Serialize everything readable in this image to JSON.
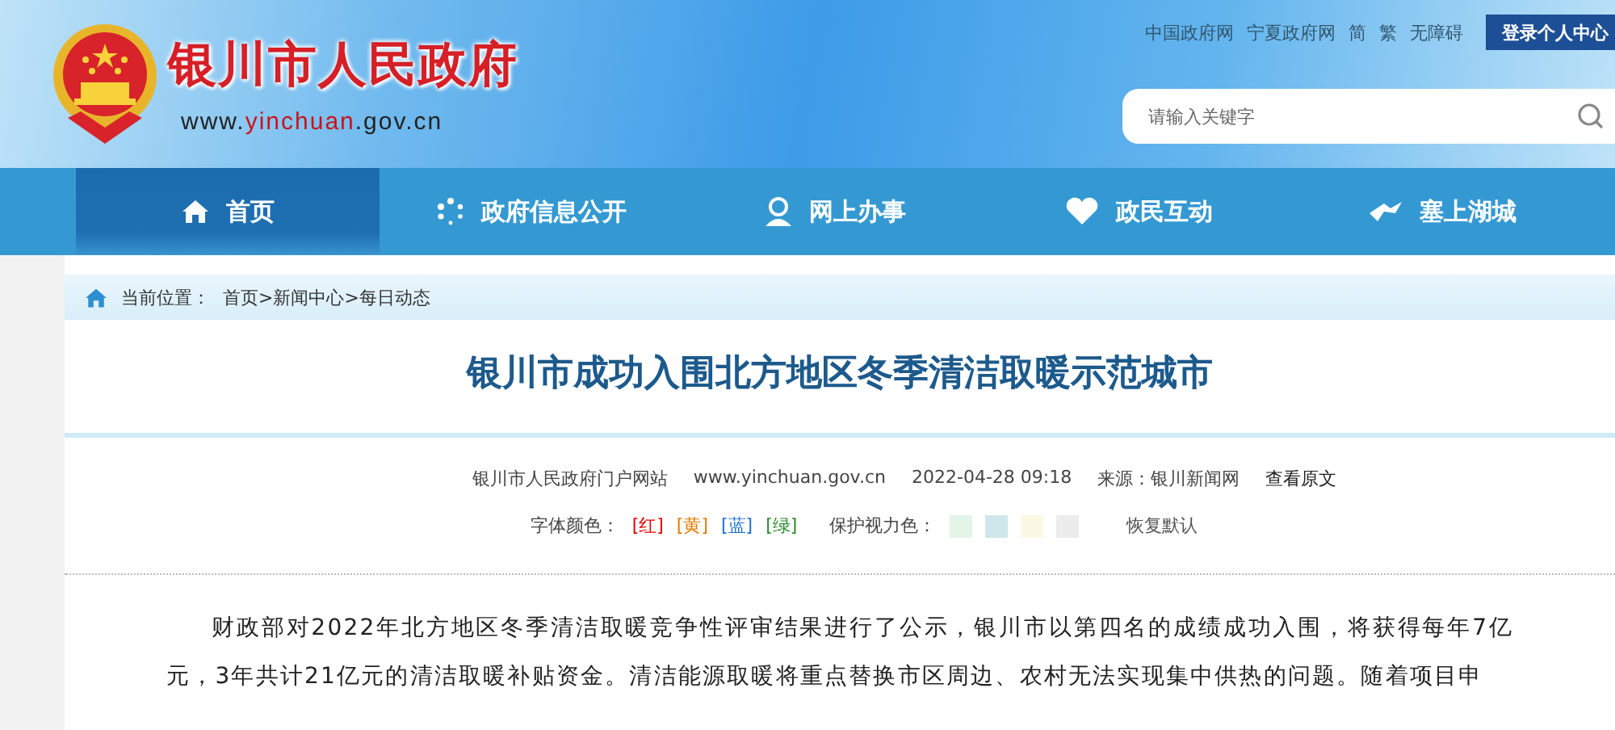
{
  "header": {
    "site_name": "银川市人民政府",
    "site_url": [
      {
        "text": "www.",
        "highlight": false
      },
      {
        "text": "yinchuan",
        "highlight": true
      },
      {
        "text": ".gov.cn",
        "highlight": false
      }
    ],
    "top_links": [
      "中国政府网",
      "宁夏政府网",
      "简",
      "繁",
      "无障碍"
    ],
    "login_button": "登录个人中心",
    "search": {
      "placeholder": "请输入关键字"
    }
  },
  "nav": [
    {
      "label": "首页",
      "kind": "home",
      "selected": true
    },
    {
      "label": "政府信息公开",
      "kind": "dots",
      "selected": false
    },
    {
      "label": "网上办事",
      "kind": "person",
      "selected": false
    },
    {
      "label": "政民互动",
      "kind": "heart",
      "selected": false
    },
    {
      "label": "塞上湖城",
      "kind": "bird",
      "selected": false
    }
  ],
  "breadcrumb": {
    "label": "当前位置：",
    "path": "首页>新闻中心>每日动态"
  },
  "article": {
    "title": "银川市成功入围北方地区冬季清洁取暖示范城市",
    "meta": [
      "银川市人民政府门户网站",
      "www.yinchuan.gov.cn",
      "2022-04-28 09:18",
      "来源：银川新闻网"
    ],
    "view_original": "查看原文",
    "font_color_label": "字体颜色：",
    "font_colors": [
      {
        "label": "[红]",
        "color": "#e60000"
      },
      {
        "label": "[黄]",
        "color": "#e07b00"
      },
      {
        "label": "[蓝]",
        "color": "#1f6fd6"
      },
      {
        "label": "[绿]",
        "color": "#2a8a2a"
      }
    ],
    "eye_color_label": "保护视力色：",
    "eye_colors": [
      {
        "color": "#e3f5e6"
      },
      {
        "color": "#cfe6ea"
      },
      {
        "color": "#fbf8e4"
      },
      {
        "color": "#ececec"
      }
    ],
    "reset": "恢复默认",
    "paragraph": "财政部对2022年北方地区冬季清洁取暖竞争性评审结果进行了公示，银川市以第四名的成绩成功入围，将获得每年7亿元，3年共计21亿元的清洁取暖补贴资金。清洁能源取暖将重点替换市区周边、农村无法实现集中供热的问题。随着项目申"
  }
}
